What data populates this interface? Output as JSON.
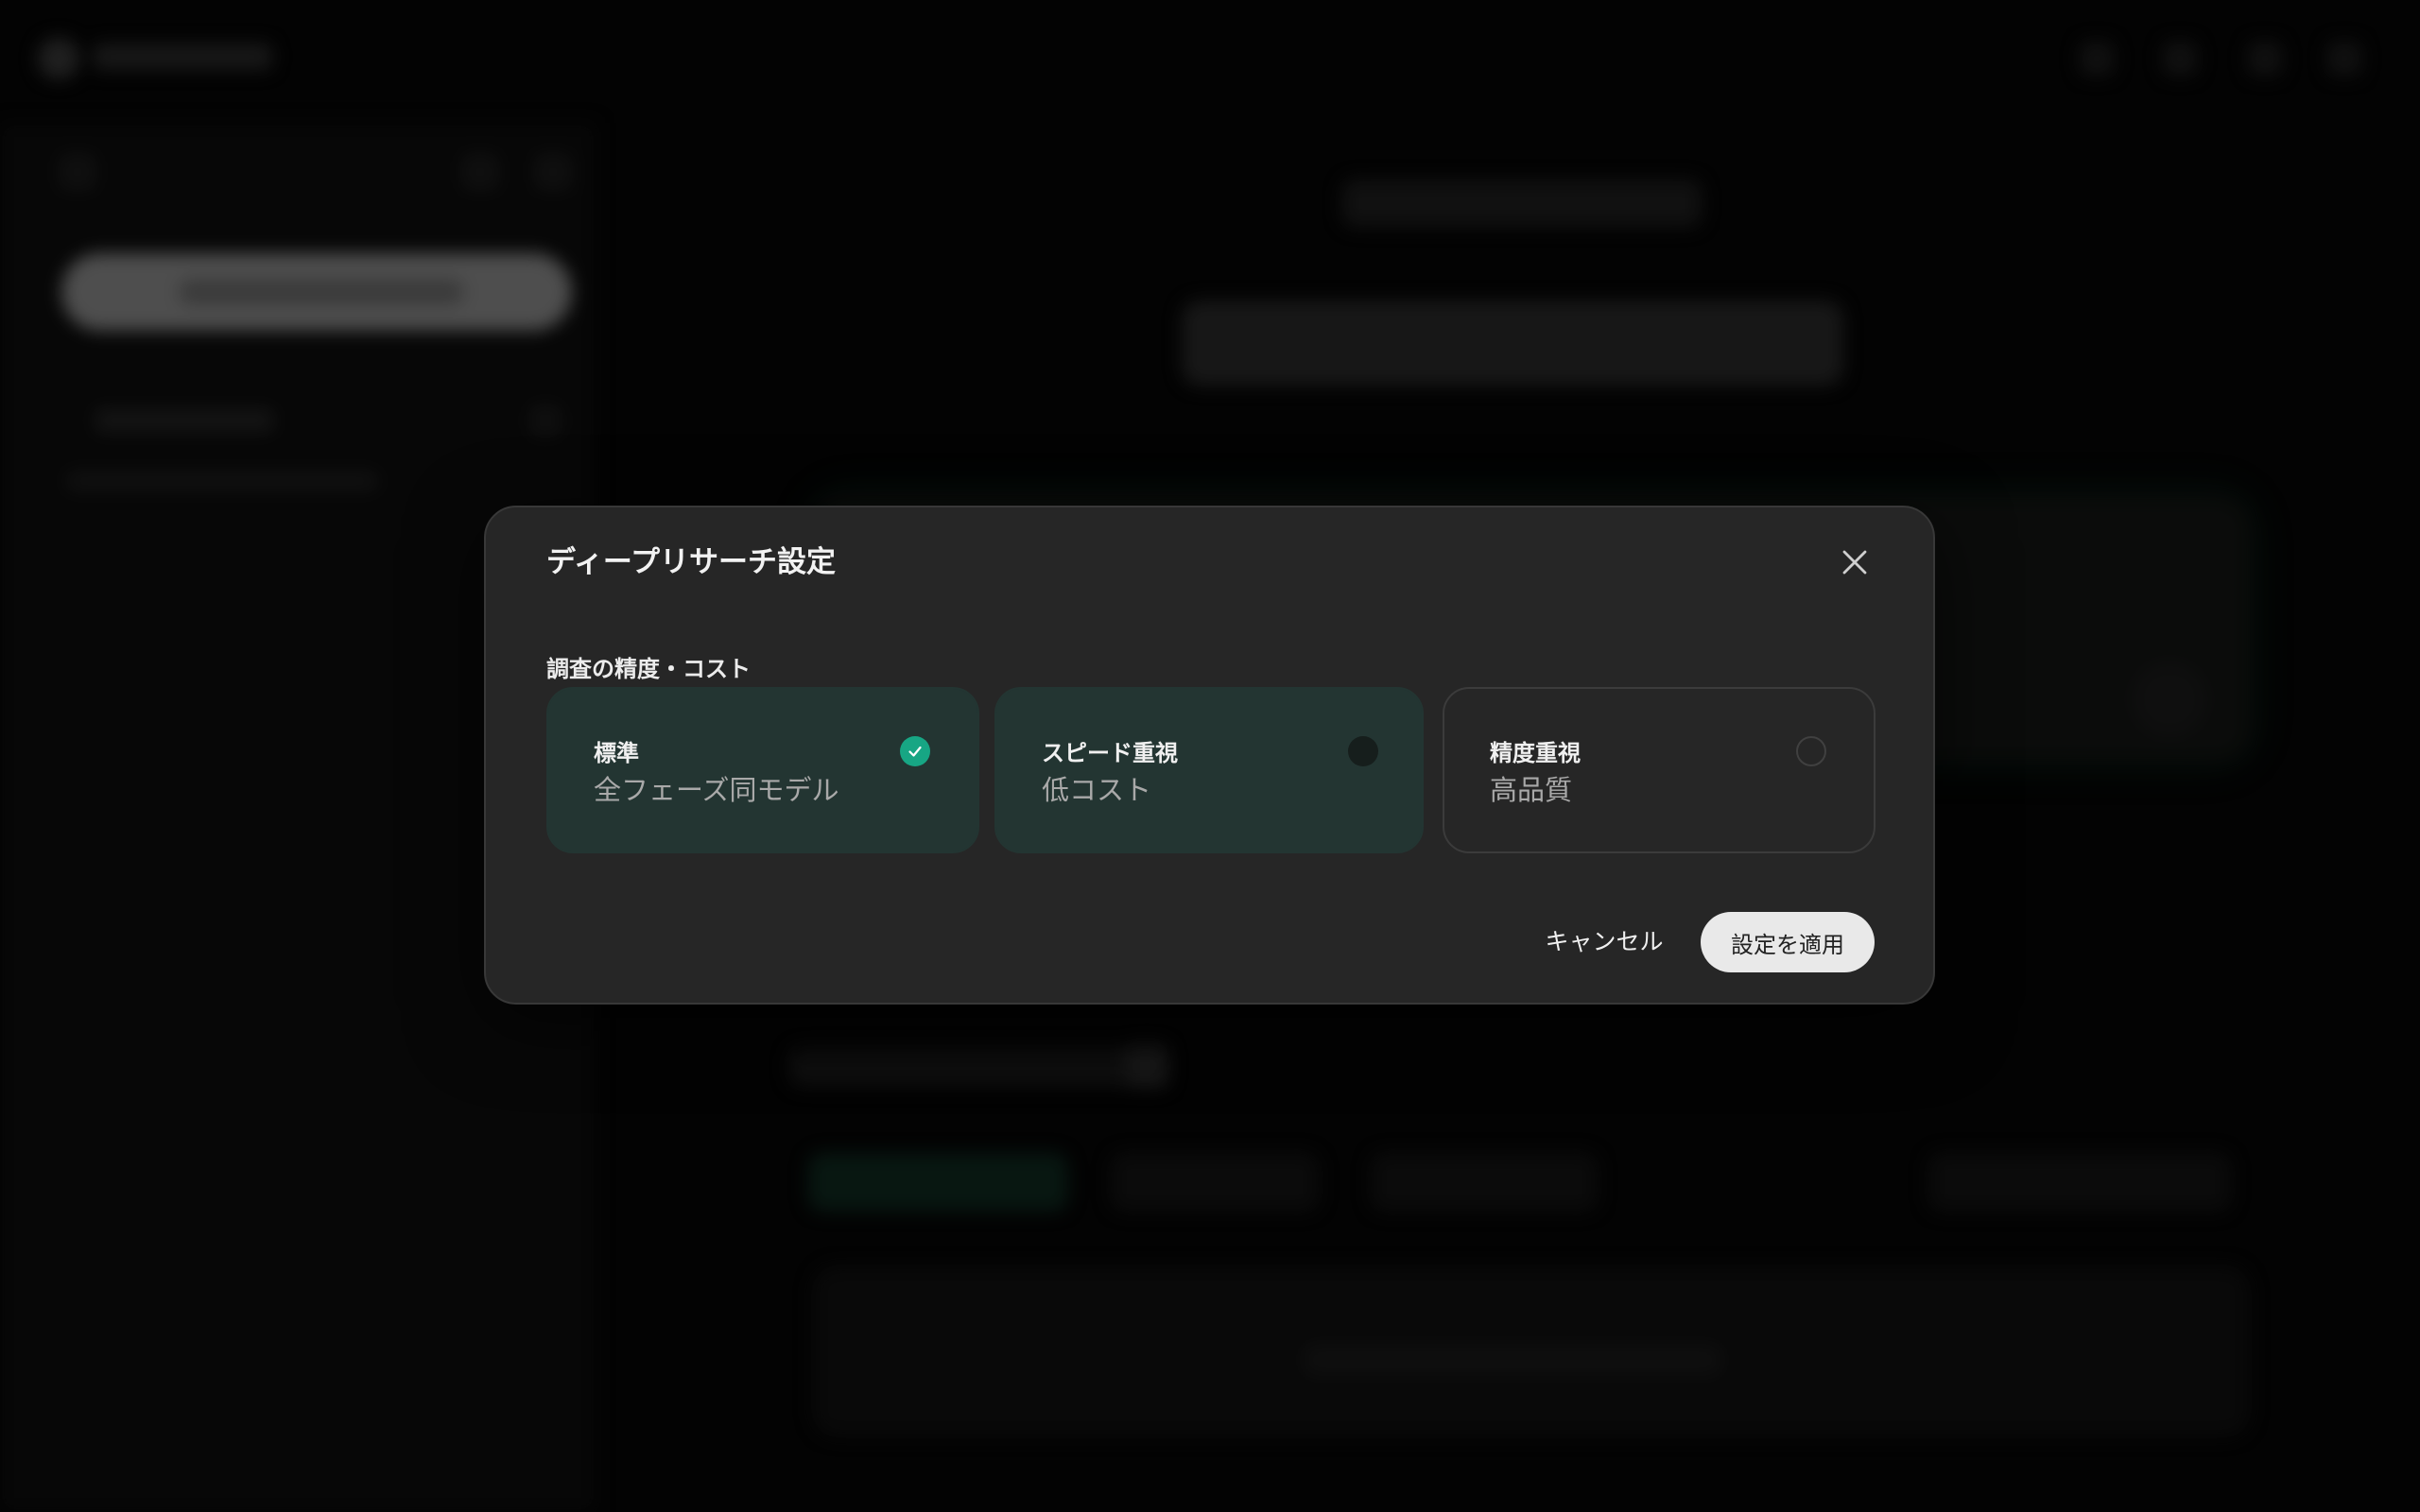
{
  "dialog": {
    "title": "ディープリサーチ設定",
    "close_icon": "close-icon",
    "section_label": "調査の精度・コスト",
    "options": [
      {
        "title": "標準",
        "description": "全フェーズ同モデル",
        "selected": true,
        "indicator": "check-circle-icon"
      },
      {
        "title": "スピード重視",
        "description": "低コスト",
        "selected": false,
        "indicator": "radio-dot-icon"
      },
      {
        "title": "精度重視",
        "description": "高品質",
        "selected": false,
        "indicator": "radio-empty-icon"
      }
    ],
    "cancel_label": "キャンセル",
    "apply_label": "設定を適用"
  },
  "colors": {
    "accent": "#17a684",
    "option_selected_bg": "#233532",
    "dialog_bg": "#262626",
    "apply_button_bg": "#e9e9e9"
  }
}
